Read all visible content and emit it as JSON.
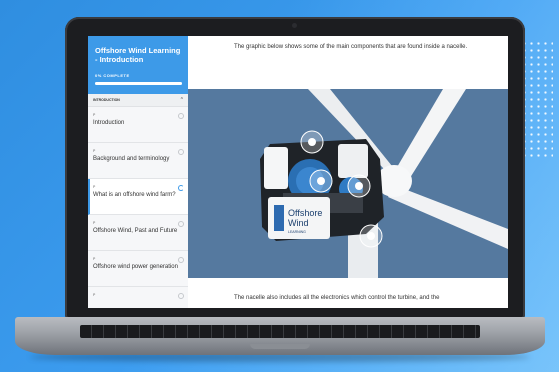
{
  "course": {
    "title": "Offshore Wind Learning - Introduction",
    "progress_label": "0% COMPLETE",
    "progress_fraction": 1.0
  },
  "sidebar": {
    "section_header": "INTRODUCTION",
    "lessons": [
      {
        "tag": "P",
        "label": "Introduction"
      },
      {
        "tag": "P",
        "label": "Background and terminology"
      },
      {
        "tag": "P",
        "label": "What is an offshore wind farm?"
      },
      {
        "tag": "P",
        "label": "Offshore Wind, Past and Future"
      },
      {
        "tag": "P",
        "label": "Offshore wind power generation"
      },
      {
        "tag": "P",
        "label": ""
      }
    ]
  },
  "main": {
    "intro_text": "The graphic below shows some of the main components that are found inside a nacelle.",
    "outro_text": "The nacelle also includes all the electronics which control the turbine, and the",
    "graphic": {
      "logo_line1": "Offshore",
      "logo_line2": "Wind",
      "logo_line3": "LEARNING",
      "background_color": "#55799f"
    }
  }
}
